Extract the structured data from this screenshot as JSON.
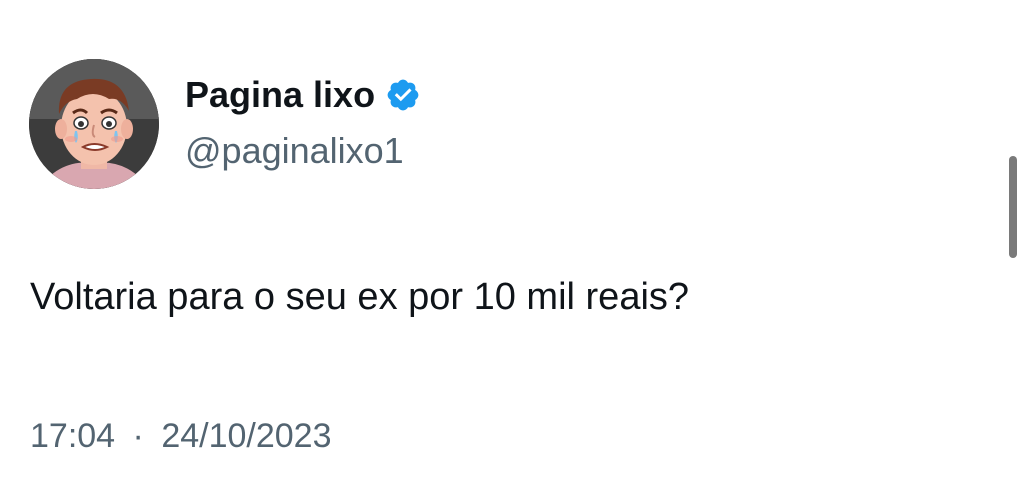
{
  "tweet": {
    "author": {
      "display_name": "Pagina lixo",
      "handle": "@paginalixo1",
      "verified": true,
      "avatar_icon": "cartoon-face-avatar"
    },
    "text": "Voltaria para o seu ex por 10 mil reais?",
    "time": "17:04",
    "separator": "·",
    "date": "24/10/2023"
  },
  "colors": {
    "text_primary": "#0f1419",
    "text_secondary": "#536471",
    "verified_blue": "#1d9bf0",
    "scrollbar": "#7a7a7a"
  }
}
